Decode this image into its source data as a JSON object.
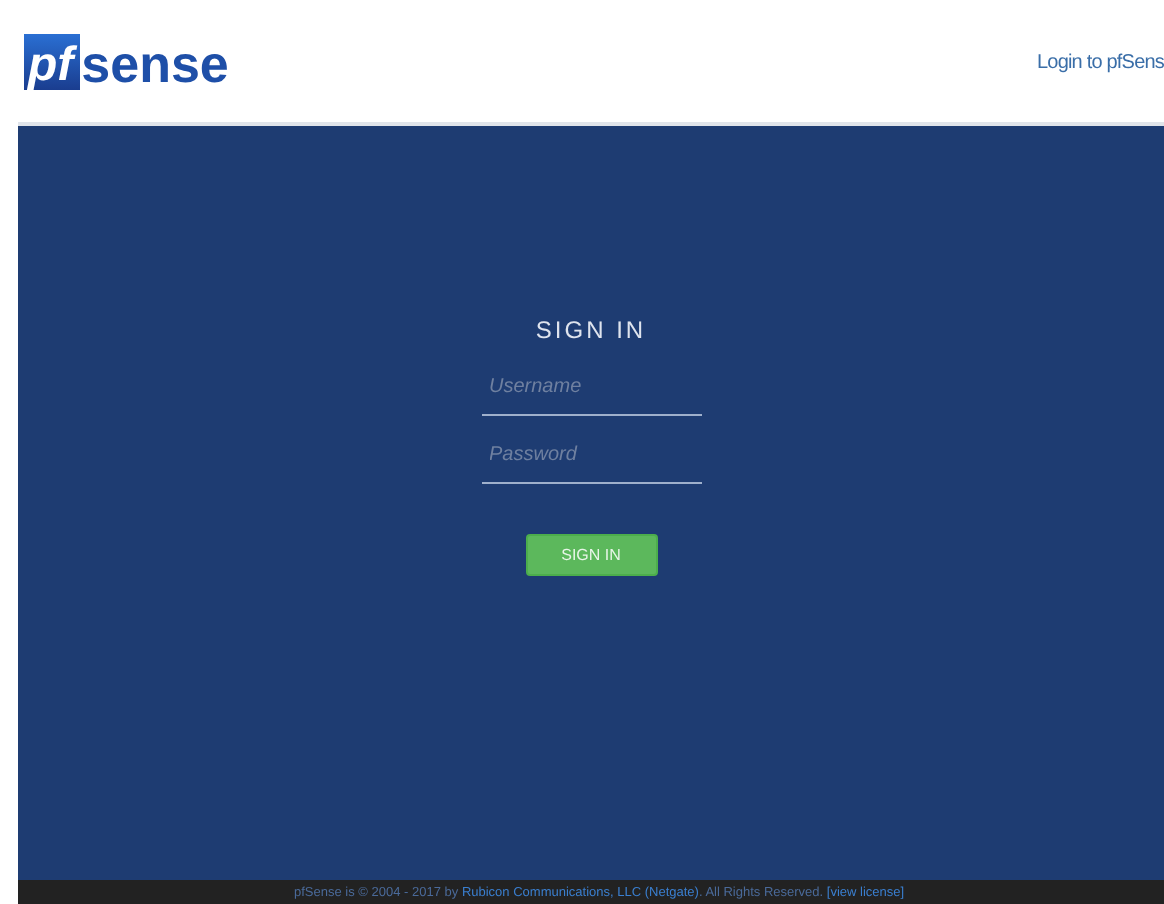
{
  "header": {
    "logo": {
      "prefix": "pf",
      "name": "sense"
    },
    "link": "Login to pfSens"
  },
  "login": {
    "title": "SIGN IN",
    "fields": [
      {
        "placeholder": "Username"
      },
      {
        "placeholder": "Password"
      }
    ],
    "button": "SIGN IN"
  },
  "footer": {
    "parts": [
      {
        "text": "pfSense is © 2004 - 2017 by ",
        "kind": "plain"
      },
      {
        "text": "Rubicon Communications, LLC (Netgate)",
        "kind": "link"
      },
      {
        "text": ". All Rights Reserved. ",
        "kind": "plain"
      },
      {
        "text": "[view license]",
        "kind": "link"
      }
    ]
  }
}
